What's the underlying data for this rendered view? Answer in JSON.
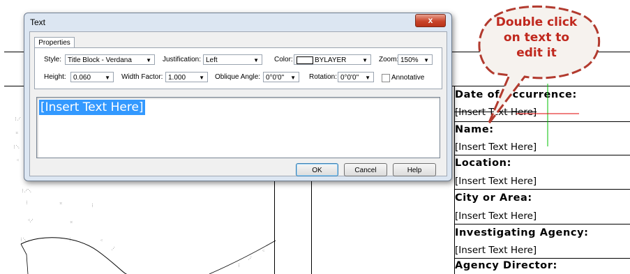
{
  "dialog": {
    "title": "Text",
    "close_symbol": "x",
    "tab_label": "Properties",
    "style_label": "Style:",
    "style_value": "Title Block - Verdana",
    "justification_label": "Justification:",
    "justification_value": "Left",
    "color_label": "Color:",
    "color_value": "BYLAYER",
    "zoom_label": "Zoom:",
    "zoom_value": "150%",
    "height_label": "Height:",
    "height_value": "0.060",
    "width_factor_label": "Width Factor:",
    "width_factor_value": "1.000",
    "oblique_label": "Oblique Angle:",
    "oblique_value": "0°0'0\"",
    "rotation_label": "Rotation:",
    "rotation_value": "0°0'0\"",
    "annotative_label": "Annotative",
    "annotative_checked": false,
    "editor_text": "[Insert Text Here]",
    "ok_label": "OK",
    "cancel_label": "Cancel",
    "help_label": "Help"
  },
  "callout": {
    "text_lines": [
      "Double click",
      "on text to",
      "edit it"
    ]
  },
  "title_block": {
    "rows": [
      {
        "heading": "Date of Occurrence:",
        "value": "[Insert Text Here]"
      },
      {
        "heading": "Name:",
        "value": "[Insert Text Here]"
      },
      {
        "heading": "Location:",
        "value": "[Insert Text Here]"
      },
      {
        "heading": "City or Area:",
        "value": "[Insert Text Here]"
      },
      {
        "heading": "Investigating Agency:",
        "value": "[Insert Text Here]"
      },
      {
        "heading": "Agency Director:",
        "value": ""
      }
    ]
  },
  "colors": {
    "callout_red": "#c0281e",
    "selection_blue": "#3399ff",
    "cursor_green": "#00c000",
    "cursor_red": "#e00000"
  }
}
